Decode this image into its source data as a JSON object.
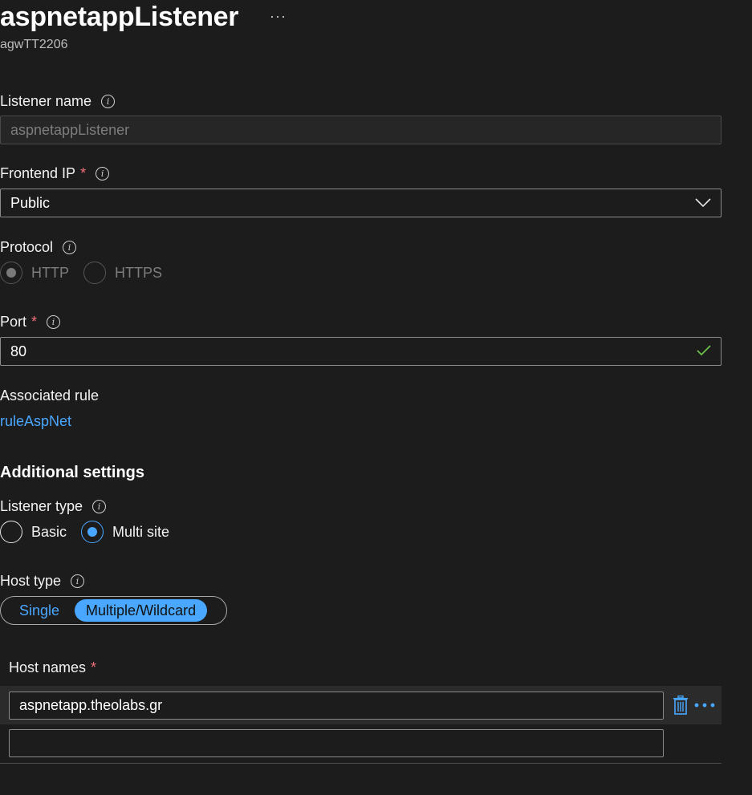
{
  "header": {
    "title": "aspnetappListener",
    "subtitle": "agwTT2206",
    "more_label": "···"
  },
  "listener_name": {
    "label": "Listener name",
    "value": "aspnetappListener"
  },
  "frontend_ip": {
    "label": "Frontend IP",
    "required_mark": "*",
    "value": "Public"
  },
  "protocol": {
    "label": "Protocol",
    "options": [
      "HTTP",
      "HTTPS"
    ],
    "selected": "HTTP"
  },
  "port": {
    "label": "Port",
    "required_mark": "*",
    "value": "80"
  },
  "associated_rule": {
    "label": "Associated rule",
    "link": "ruleAspNet"
  },
  "additional_settings": {
    "heading": "Additional settings"
  },
  "listener_type": {
    "label": "Listener type",
    "options": [
      "Basic",
      "Multi site"
    ],
    "selected": "Multi site"
  },
  "host_type": {
    "label": "Host type",
    "options": [
      "Single",
      "Multiple/Wildcard"
    ],
    "selected": "Multiple/Wildcard"
  },
  "host_names": {
    "label": "Host names",
    "required_mark": "*",
    "values": [
      "aspnetapp.theolabs.gr",
      ""
    ]
  },
  "colors": {
    "background": "#1c1c1c",
    "accent": "#4aa7ff",
    "required": "#f1707b",
    "success": "#6cc04a"
  }
}
